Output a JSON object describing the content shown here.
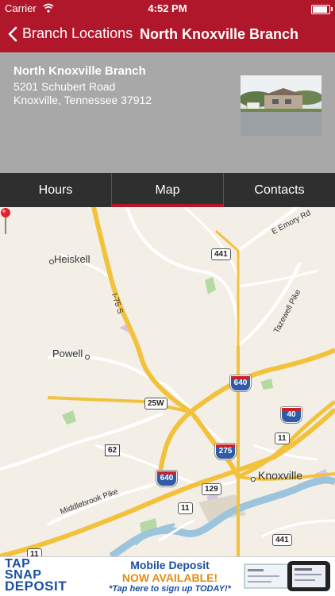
{
  "status": {
    "carrier": "Carrier",
    "time": "4:52 PM"
  },
  "nav": {
    "back_label": "Branch Locations",
    "title": "North Knoxville Branch"
  },
  "branch": {
    "name": "North Knoxville Branch",
    "address_line1": "5201 Schubert Road",
    "address_line2": "Knoxville, Tennessee 37912"
  },
  "tabs": [
    {
      "label": "Hours",
      "active": false
    },
    {
      "label": "Map",
      "active": true
    },
    {
      "label": "Contacts",
      "active": false
    }
  ],
  "map": {
    "labels": {
      "heiskell": "Heiskell",
      "powell": "Powell",
      "knoxville": "Knoxville",
      "emory": "E Emory Rd",
      "tazewell": "Tazewell Pike",
      "i75": "I-75 S",
      "middlebrook": "Middlebrook Pike"
    },
    "shields": {
      "us441a": "441",
      "us25w": "25W",
      "i640a": "640",
      "i40": "40",
      "us11a": "11",
      "tn62": "62",
      "i275": "275",
      "i640b": "640",
      "s129": "129",
      "us11b": "11",
      "us441b": "441",
      "us11c": "11"
    }
  },
  "ad": {
    "logo_line1": "TAP",
    "logo_line2": "SNAP",
    "logo_line3": "DEPOSIT",
    "headline1": "Mobile Deposit",
    "headline2": "NOW AVAILABLE!",
    "cta": "*Tap here to sign up TODAY!*"
  }
}
